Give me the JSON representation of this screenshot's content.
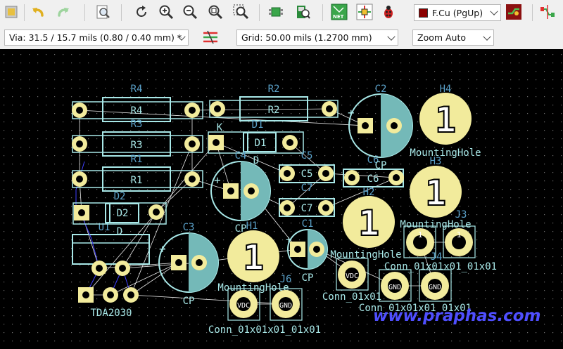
{
  "toolbar": {
    "icons": [
      "copper-fill-icon",
      "undo-icon",
      "redo-icon",
      "print-preview-icon",
      "refresh-icon",
      "zoom-in-icon",
      "zoom-out-icon",
      "zoom-fit-icon",
      "zoom-selection-icon",
      "footprint-editor-icon",
      "footprint-library-icon",
      "netlist-icon",
      "update-pcb-icon",
      "drc-bug-icon",
      "layer-pair-icon",
      "route-icon"
    ],
    "layer_select": "F.Cu (PgUp)",
    "layer_color": "#8b0000"
  },
  "toolbar2": {
    "via": "Via: 31.5 / 15.7 mils (0.80 / 0.40 mm) *",
    "grid": "Grid: 50.00 mils (1.2700 mm)",
    "zoom": "Zoom Auto"
  },
  "colors": {
    "pad": "#f2eb9c",
    "outline": "#a8e8e8",
    "capFill": "#74b9b8",
    "ref": "#5aa0c8",
    "value": "#a8e8e8",
    "rats": "#e8e8e8",
    "trace": "#4040ff",
    "background": "#000000"
  },
  "components": {
    "r4_ref": "R4",
    "r4_val": "R4",
    "r2_ref": "R2",
    "r2_val": "R2",
    "r3_ref": "R3",
    "r3_val": "R3",
    "r1_ref": "R1",
    "r1_val": "R1",
    "d1_ref": "D1",
    "d1_val": "D1",
    "d1_k": "K",
    "d1_a": "D",
    "d2_ref": "D2",
    "d2_val": "D2",
    "d2_a": "D",
    "c1_ref": "C1",
    "c1_val": "CP",
    "c2_ref": "C2",
    "c2_val": "CP",
    "c3_ref": "C3",
    "c3_val": "CP",
    "c4_ref": "C4",
    "c4_val": "CP",
    "c5_ref": "C5",
    "c5_val": "C5",
    "c6_ref": "C6",
    "c6_val": "C6",
    "c7_ref": "C7",
    "c7_val": "C7",
    "u1_ref": "U1",
    "u1_val": "TDA2030",
    "h1_ref": "H1",
    "h1_val": "MountingHole",
    "h2_ref": "H2",
    "h2_val": "MountingHole",
    "h3_ref": "H3",
    "h3_val": "MountingHole",
    "h4_ref": "H4",
    "h4_val": "MountingHole",
    "hole_pad": "1",
    "j3_ref": "J3",
    "j4_ref": "J4",
    "j6_ref": "J6",
    "conn_val": "Conn_01x01",
    "conn_vals_a": "Conn_01x01x01_01x01",
    "vdc": "VDC",
    "gnd": "GND",
    "pin": "1"
  },
  "watermark": "www.praphas.com"
}
